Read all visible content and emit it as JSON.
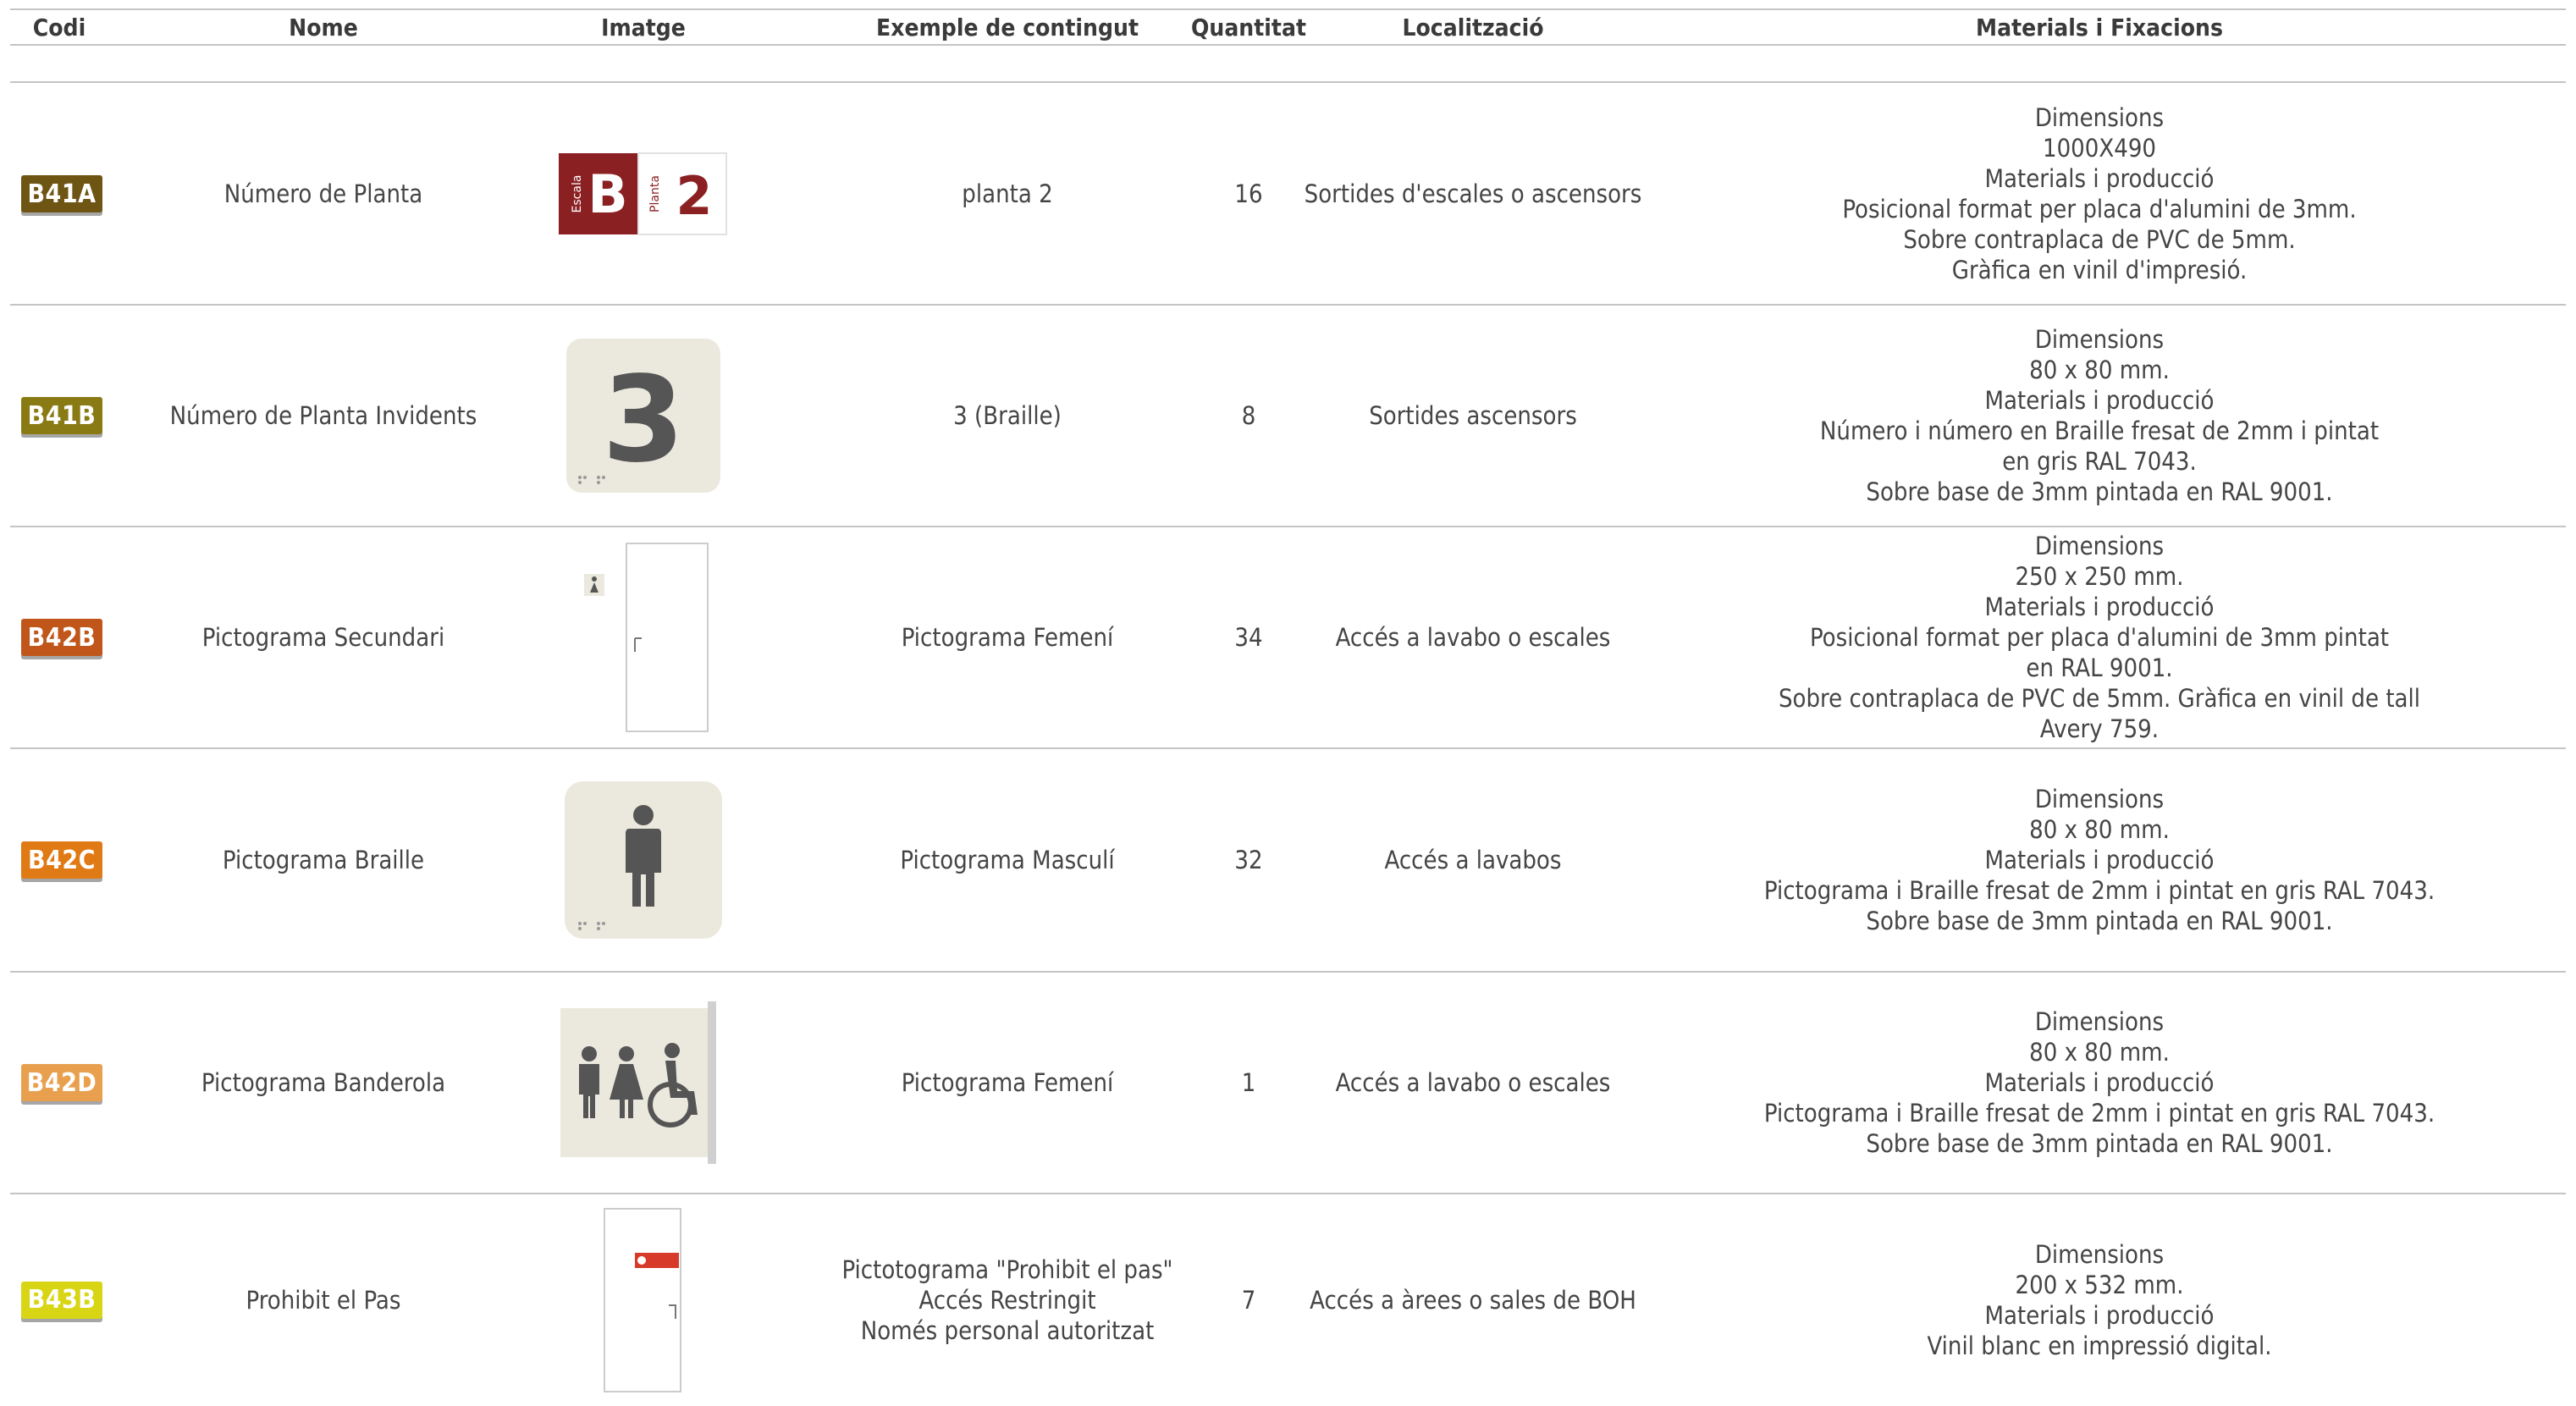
{
  "headers": {
    "codi": "Codi",
    "nome": "Nome",
    "imatge": "Imatge",
    "exemple": "Exemple de contingut",
    "quantitat": "Quantitat",
    "localitzacio": "Localització",
    "materials": "Materials i Fixacions"
  },
  "rows": [
    {
      "codi": "B41A",
      "badge_color": "#6e5514",
      "nom": "Número de Planta",
      "image": {
        "type": "floor-sign",
        "letter": "B",
        "number": "2",
        "label_left": "Escala",
        "label_right": "Planta"
      },
      "exemple": [
        "planta 2"
      ],
      "quantitat": "16",
      "localitzacio": "Sortides d'escales o ascensors",
      "materials": [
        "Dimensions",
        "1000X490",
        "Materials i producció",
        "Posicional format per placa d'alumini de 3mm.",
        "Sobre contraplaca de PVC de 5mm.",
        "Gràfica en vinil d'impresió."
      ]
    },
    {
      "codi": "B41B",
      "badge_color": "#8a7a14",
      "nom": "Número de Planta Invidents",
      "image": {
        "type": "braille-number",
        "number": "3"
      },
      "exemple": [
        "3 (Braille)"
      ],
      "quantitat": "8",
      "localitzacio": "Sortides ascensors",
      "materials": [
        "Dimensions",
        "80 x 80 mm.",
        "Materials i producció",
        "Número i número en Braille fresat de 2mm i pintat",
        "en gris RAL 7043.",
        "Sobre base de 3mm pintada en RAL 9001."
      ]
    },
    {
      "codi": "B42B",
      "badge_color": "#c0561a",
      "nom": "Pictograma Secundari",
      "image": {
        "type": "door-pictogram"
      },
      "exemple": [
        "Pictograma Femení"
      ],
      "quantitat": "34",
      "localitzacio": "Accés a lavabo o escales",
      "materials": [
        "Dimensions",
        "250 x 250 mm.",
        "Materials i producció",
        "Posicional format per placa d'alumini de 3mm pintat",
        "en RAL 9001.",
        "Sobre contraplaca de PVC de 5mm. Gràfica en vinil de tall",
        "Avery 759."
      ]
    },
    {
      "codi": "B42C",
      "badge_color": "#e07a14",
      "nom": "Pictograma Braille",
      "image": {
        "type": "braille-male"
      },
      "exemple": [
        "Pictograma Masculí"
      ],
      "quantitat": "32",
      "localitzacio": "Accés a lavabos",
      "materials": [
        "Dimensions",
        "80 x 80 mm.",
        "Materials i producció",
        "Pictograma i Braille fresat de 2mm i pintat en gris RAL 7043.",
        "Sobre base de 3mm pintada en RAL 9001."
      ]
    },
    {
      "codi": "B42D",
      "badge_color": "#e8a04e",
      "nom": "Pictograma Banderola",
      "image": {
        "type": "banner-toilets"
      },
      "exemple": [
        "Pictograma Femení"
      ],
      "quantitat": "1",
      "localitzacio": "Accés a lavabo o escales",
      "materials": [
        "Dimensions",
        "80 x 80 mm.",
        "Materials i producció",
        "Pictograma i Braille fresat de 2mm i pintat en gris RAL 7043.",
        "Sobre base de 3mm pintada en RAL 9001."
      ]
    },
    {
      "codi": "B43B",
      "badge_color": "#d8d614",
      "nom": "Prohibit el Pas",
      "image": {
        "type": "door-prohibited"
      },
      "exemple": [
        "Pictotograma \"Prohibit el pas\"",
        "Accés Restringit",
        "Només personal autoritzat"
      ],
      "quantitat": "7",
      "localitzacio": "Accés a àrees o sales de BOH",
      "materials": [
        "Dimensions",
        "200 x 532 mm.",
        "Materials i producció",
        "Vinil blanc en impressió digital."
      ]
    }
  ]
}
